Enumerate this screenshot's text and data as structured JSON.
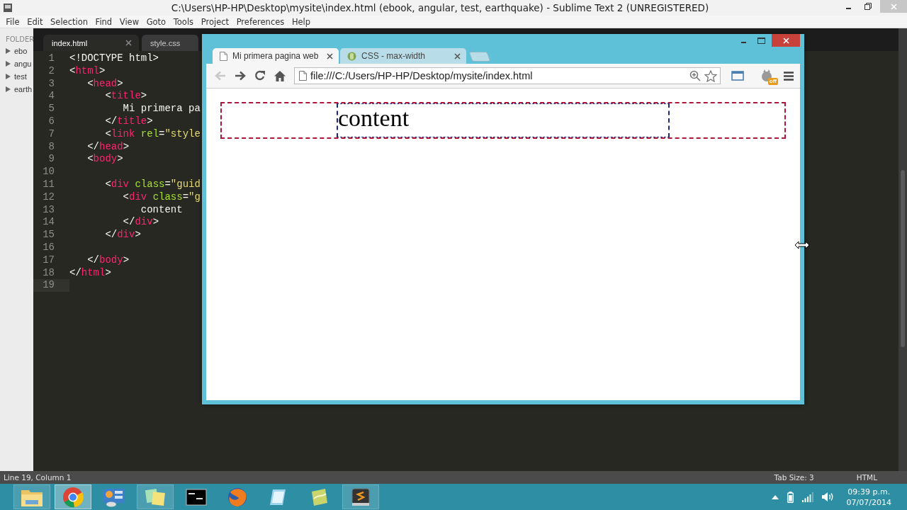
{
  "editor": {
    "title": "C:\\Users\\HP-HP\\Desktop\\mysite\\index.html (ebook, angular, test, earthquake) - Sublime Text 2 (UNREGISTERED)",
    "menu": [
      "File",
      "Edit",
      "Selection",
      "Find",
      "View",
      "Goto",
      "Tools",
      "Project",
      "Preferences",
      "Help"
    ],
    "sidebar": {
      "heading": "FOLDER",
      "folders": [
        {
          "label": "ebo",
          "expanded": false
        },
        {
          "label": "angu",
          "expanded": false
        },
        {
          "label": "test",
          "expanded": false
        },
        {
          "label": "earth",
          "expanded": false
        }
      ]
    },
    "tabs": [
      {
        "label": "index.html",
        "selected": true
      },
      {
        "label": "style.css",
        "selected": false
      }
    ],
    "lines": [
      {
        "number": "1",
        "current": false,
        "tokens": [
          {
            "kind": "plain",
            "text": "<!DOCTYPE html>"
          }
        ]
      },
      {
        "number": "2",
        "current": false,
        "tokens": [
          {
            "kind": "plain",
            "text": "<"
          },
          {
            "kind": "tag",
            "text": "html"
          },
          {
            "kind": "plain",
            "text": ">"
          }
        ]
      },
      {
        "number": "3",
        "current": false,
        "tokens": [
          {
            "kind": "plain",
            "text": "   <"
          },
          {
            "kind": "tag",
            "text": "head"
          },
          {
            "kind": "plain",
            "text": ">"
          }
        ]
      },
      {
        "number": "4",
        "current": false,
        "tokens": [
          {
            "kind": "plain",
            "text": "      <"
          },
          {
            "kind": "tag",
            "text": "title"
          },
          {
            "kind": "plain",
            "text": ">"
          }
        ]
      },
      {
        "number": "5",
        "current": false,
        "tokens": [
          {
            "kind": "plain",
            "text": "         Mi primera pa"
          }
        ]
      },
      {
        "number": "6",
        "current": false,
        "tokens": [
          {
            "kind": "plain",
            "text": "      </"
          },
          {
            "kind": "tag",
            "text": "title"
          },
          {
            "kind": "plain",
            "text": ">"
          }
        ]
      },
      {
        "number": "7",
        "current": false,
        "tokens": [
          {
            "kind": "plain",
            "text": "      <"
          },
          {
            "kind": "tag",
            "text": "link"
          },
          {
            "kind": "attr",
            "text": " rel"
          },
          {
            "kind": "plain",
            "text": "="
          },
          {
            "kind": "string",
            "text": "\"style"
          }
        ]
      },
      {
        "number": "8",
        "current": false,
        "tokens": [
          {
            "kind": "plain",
            "text": "   </"
          },
          {
            "kind": "tag",
            "text": "head"
          },
          {
            "kind": "plain",
            "text": ">"
          }
        ]
      },
      {
        "number": "9",
        "current": false,
        "tokens": [
          {
            "kind": "plain",
            "text": "   <"
          },
          {
            "kind": "tag",
            "text": "body"
          },
          {
            "kind": "plain",
            "text": ">"
          }
        ]
      },
      {
        "number": "10",
        "current": false
      },
      {
        "number": "11",
        "current": false,
        "tokens": [
          {
            "kind": "plain",
            "text": "      <"
          },
          {
            "kind": "tag",
            "text": "div"
          },
          {
            "kind": "attr",
            "text": " class"
          },
          {
            "kind": "plain",
            "text": "="
          },
          {
            "kind": "string",
            "text": "\"guid"
          }
        ]
      },
      {
        "number": "12",
        "current": false,
        "tokens": [
          {
            "kind": "plain",
            "text": "         <"
          },
          {
            "kind": "tag",
            "text": "div"
          },
          {
            "kind": "attr",
            "text": " class"
          },
          {
            "kind": "plain",
            "text": "="
          },
          {
            "kind": "string",
            "text": "\"g"
          }
        ]
      },
      {
        "number": "13",
        "current": false,
        "tokens": [
          {
            "kind": "plain",
            "text": "            content"
          }
        ]
      },
      {
        "number": "14",
        "current": false,
        "tokens": [
          {
            "kind": "plain",
            "text": "         </"
          },
          {
            "kind": "tag",
            "text": "div"
          },
          {
            "kind": "plain",
            "text": ">"
          }
        ]
      },
      {
        "number": "15",
        "current": false,
        "tokens": [
          {
            "kind": "plain",
            "text": "      </"
          },
          {
            "kind": "tag",
            "text": "div"
          },
          {
            "kind": "plain",
            "text": ">"
          }
        ]
      },
      {
        "number": "16",
        "current": false
      },
      {
        "number": "17",
        "current": false,
        "tokens": [
          {
            "kind": "plain",
            "text": "   </"
          },
          {
            "kind": "tag",
            "text": "body"
          },
          {
            "kind": "plain",
            "text": ">"
          }
        ]
      },
      {
        "number": "18",
        "current": false,
        "tokens": [
          {
            "kind": "plain",
            "text": "</"
          },
          {
            "kind": "tag",
            "text": "html"
          },
          {
            "kind": "plain",
            "text": ">"
          }
        ]
      },
      {
        "number": "19",
        "current": true
      }
    ],
    "status_bar": {
      "position": "Line 19, Column 1",
      "tab_size": "Tab Size: 3",
      "syntax": "HTML"
    }
  },
  "browser": {
    "tabs": [
      {
        "label": "Mi primera pagina web",
        "kind": "page",
        "selected": true
      },
      {
        "label": "CSS - max-width",
        "kind": "site",
        "selected": false
      }
    ],
    "back_enabled": false,
    "address": "file:///C:/Users/HP-HP/Desktop/mysite/index.html",
    "extension_badge": "off",
    "page": {
      "content": "content"
    }
  },
  "taskbar": {
    "apps": [
      {
        "kind": "folder",
        "running": true,
        "selected": false
      },
      {
        "kind": "browser",
        "running": true,
        "selected": true
      },
      {
        "kind": "control-panel",
        "running": false,
        "selected": false
      },
      {
        "kind": "notes",
        "running": true,
        "selected": false
      },
      {
        "kind": "terminal",
        "running": false,
        "selected": false
      },
      {
        "kind": "globe",
        "running": false,
        "selected": false
      },
      {
        "kind": "notepad",
        "running": false,
        "selected": false
      },
      {
        "kind": "paper",
        "running": false,
        "selected": false
      },
      {
        "kind": "editor",
        "running": true,
        "selected": false
      }
    ],
    "time": "09:39 p.m.",
    "date": "07/07/2014"
  }
}
